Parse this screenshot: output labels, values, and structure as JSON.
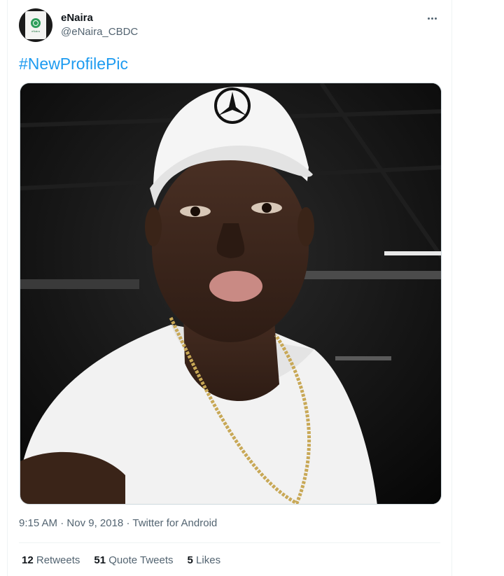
{
  "tweet": {
    "author": {
      "display_name": "eNaira",
      "handle": "@eNaira_CBDC",
      "avatar_icon": "enaira-logo-avatar",
      "avatar_text": "eNaira"
    },
    "more_icon": "more-options-icon",
    "text": "#NewProfilePic",
    "media": {
      "icon": "profile-photo"
    },
    "time": "9:15 AM",
    "date": "Nov 9, 2018",
    "source": "Twitter for Android",
    "stats": {
      "retweets_count": "12",
      "retweets_label": "Retweets",
      "quotes_count": "51",
      "quotes_label": "Quote Tweets",
      "likes_count": "5",
      "likes_label": "Likes"
    }
  },
  "colors": {
    "link": "#1d9bf0",
    "muted": "#536471",
    "text": "#0f1419",
    "border": "#eff3f4"
  }
}
